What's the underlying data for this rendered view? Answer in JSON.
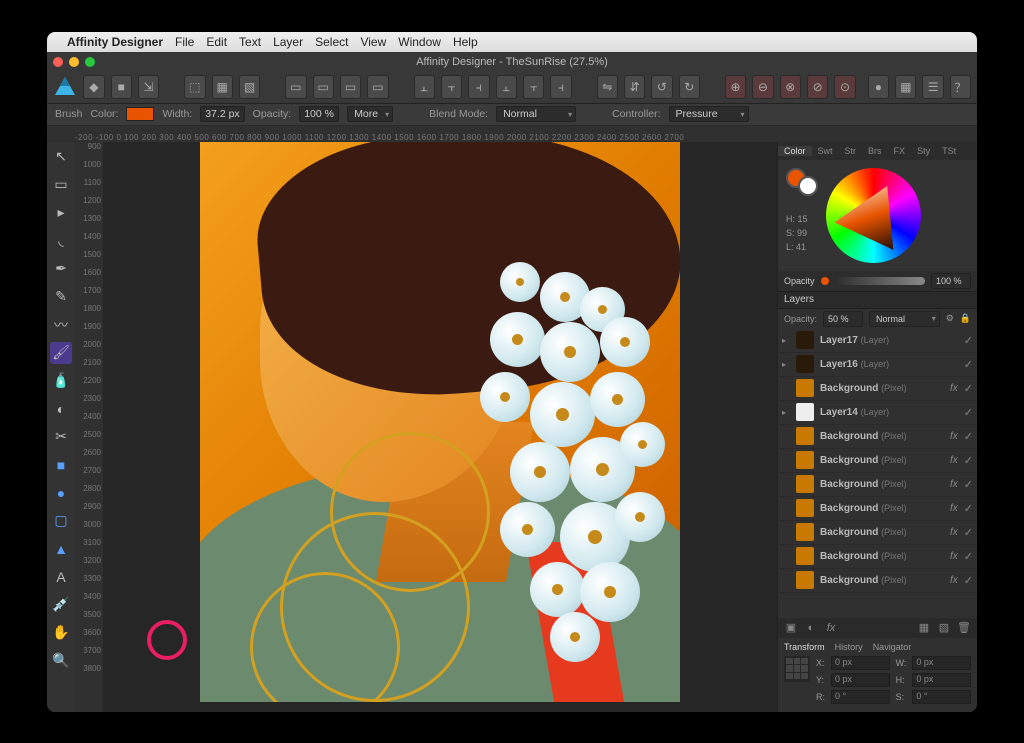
{
  "menubar": {
    "app_name": "Affinity Designer",
    "items": [
      "File",
      "Edit",
      "Text",
      "Layer",
      "Select",
      "View",
      "Window",
      "Help"
    ]
  },
  "window": {
    "title": "Affinity Designer - TheSunRise (27.5%)"
  },
  "context_bar": {
    "brush_label": "Brush",
    "color_label": "Color:",
    "color_value": "#e85400",
    "width_label": "Width:",
    "width_value": "37.2 px",
    "opacity_label": "Opacity:",
    "opacity_value": "100 %",
    "more_label": "More",
    "blend_label": "Blend Mode:",
    "blend_value": "Normal",
    "controller_label": "Controller:",
    "controller_value": "Pressure"
  },
  "ruler": {
    "top": "-200 -100 0 100 200 300 400 500 600 700 800 900 1000 1100 1200 1300 1400 1500 1600 1700 1800 1900 2000 2100 2200 2300 2400 2500 2600 2700",
    "left": [
      "900",
      "1000",
      "1100",
      "1200",
      "1300",
      "1400",
      "1500",
      "1600",
      "1700",
      "1800",
      "1900",
      "2000",
      "2100",
      "2200",
      "2300",
      "2400",
      "2500",
      "2600",
      "2700",
      "2800",
      "2900",
      "3000",
      "3100",
      "3200",
      "3300",
      "3400",
      "3500",
      "3600",
      "3700",
      "3800"
    ]
  },
  "color_panel": {
    "tabs": [
      "Color",
      "Swt",
      "Str",
      "Brs",
      "FX",
      "Sty",
      "TSt"
    ],
    "hsl": {
      "h_label": "H: 15",
      "s_label": "S: 99",
      "l_label": "L: 41"
    },
    "opacity_label": "Opacity",
    "opacity_readout": "100 %",
    "primary": "#e85400",
    "secondary": "#ffffff"
  },
  "layers_panel": {
    "title": "Layers",
    "opacity_label": "Opacity:",
    "opacity_value": "50 %",
    "blend_value": "Normal",
    "items": [
      {
        "name": "Layer17",
        "type": "(Layer)",
        "thumb": "dark",
        "arrow": true,
        "fx": false
      },
      {
        "name": "Layer16",
        "type": "(Layer)",
        "thumb": "dark",
        "arrow": true,
        "fx": false
      },
      {
        "name": "Background",
        "type": "(Pixel)",
        "thumb": "gold",
        "arrow": false,
        "fx": true
      },
      {
        "name": "Layer14",
        "type": "(Layer)",
        "thumb": "white",
        "arrow": true,
        "fx": false
      },
      {
        "name": "Background",
        "type": "(Pixel)",
        "thumb": "gold",
        "arrow": false,
        "fx": true
      },
      {
        "name": "Background",
        "type": "(Pixel)",
        "thumb": "gold",
        "arrow": false,
        "fx": true
      },
      {
        "name": "Background",
        "type": "(Pixel)",
        "thumb": "gold",
        "arrow": false,
        "fx": true
      },
      {
        "name": "Background",
        "type": "(Pixel)",
        "thumb": "gold",
        "arrow": false,
        "fx": true
      },
      {
        "name": "Background",
        "type": "(Pixel)",
        "thumb": "gold",
        "arrow": false,
        "fx": true
      },
      {
        "name": "Background",
        "type": "(Pixel)",
        "thumb": "gold",
        "arrow": false,
        "fx": true
      },
      {
        "name": "Background",
        "type": "(Pixel)",
        "thumb": "gold",
        "arrow": false,
        "fx": true
      }
    ]
  },
  "transform_panel": {
    "tabs": [
      "Transform",
      "History",
      "Navigator"
    ],
    "x_label": "X:",
    "x_value": "0 px",
    "y_label": "Y:",
    "y_value": "0 px",
    "w_label": "W:",
    "w_value": "0 px",
    "h_label": "H:",
    "h_value": "0 px",
    "r_label": "R:",
    "r_value": "0 °",
    "s_label": "S:",
    "s_value": "0 °"
  }
}
